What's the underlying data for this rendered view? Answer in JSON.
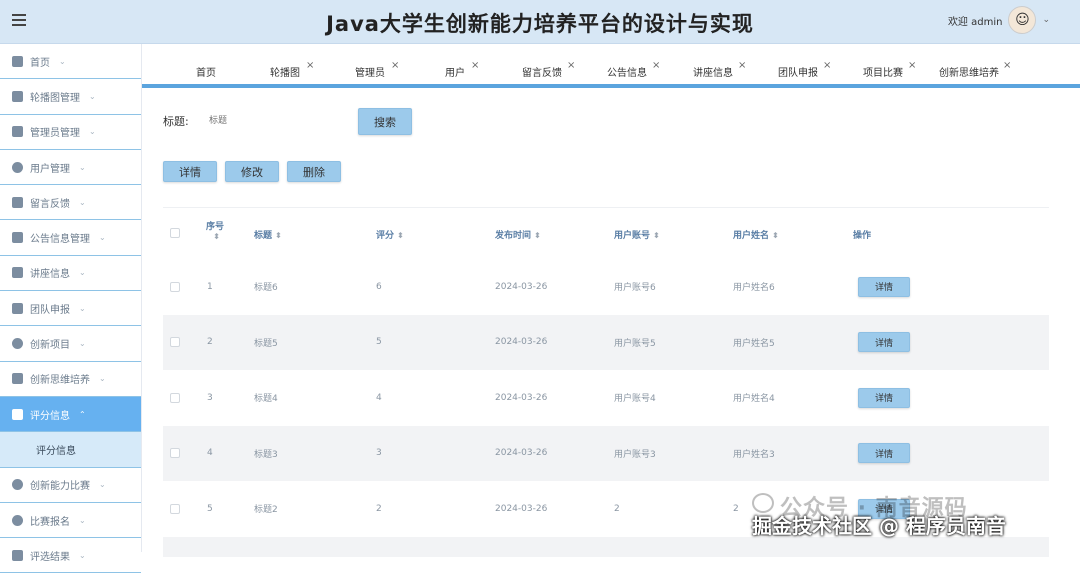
{
  "header": {
    "title": "Java大学生创新能力培养平台的设计与实现",
    "welcome": "欢迎 admin"
  },
  "sidebar": {
    "items": [
      {
        "label": "首页",
        "icon": "home-icon"
      },
      {
        "label": "轮播图管理",
        "icon": "carousel-icon"
      },
      {
        "label": "管理员管理",
        "icon": "admin-icon"
      },
      {
        "label": "用户管理",
        "icon": "user-icon"
      },
      {
        "label": "留言反馈",
        "icon": "message-icon"
      },
      {
        "label": "公告信息管理",
        "icon": "notice-icon"
      },
      {
        "label": "讲座信息",
        "icon": "lecture-icon"
      },
      {
        "label": "团队申报",
        "icon": "team-icon"
      },
      {
        "label": "创新项目",
        "icon": "project-icon"
      },
      {
        "label": "创新思维培养",
        "icon": "mail-icon"
      },
      {
        "label": "评分信息",
        "icon": "grid-icon"
      },
      {
        "label": "创新能力比赛",
        "icon": "compete-icon"
      },
      {
        "label": "比赛报名",
        "icon": "drop-icon"
      },
      {
        "label": "评选结果",
        "icon": "result-icon"
      }
    ],
    "sub_item": "评分信息"
  },
  "tabs": [
    "首页",
    "轮播图",
    "管理员",
    "用户",
    "留言反馈",
    "公告信息",
    "讲座信息",
    "团队申报",
    "项目比赛",
    "创新思维培养"
  ],
  "search": {
    "label": "标题:",
    "placeholder": "标题",
    "button": "搜索"
  },
  "actions": {
    "detail": "详情",
    "edit": "修改",
    "delete": "删除"
  },
  "table": {
    "headers": [
      "序号",
      "标题",
      "评分",
      "发布时间",
      "用户账号",
      "用户姓名",
      "操作"
    ],
    "rows": [
      {
        "no": "1",
        "title": "标题6",
        "score": "6",
        "time": "2024-03-26",
        "account": "用户账号6",
        "name": "用户姓名6",
        "op": "详情"
      },
      {
        "no": "2",
        "title": "标题5",
        "score": "5",
        "time": "2024-03-26",
        "account": "用户账号5",
        "name": "用户姓名5",
        "op": "详情"
      },
      {
        "no": "3",
        "title": "标题4",
        "score": "4",
        "time": "2024-03-26",
        "account": "用户账号4",
        "name": "用户姓名4",
        "op": "详情"
      },
      {
        "no": "4",
        "title": "标题3",
        "score": "3",
        "time": "2024-03-26",
        "account": "用户账号3",
        "name": "用户姓名3",
        "op": "详情"
      },
      {
        "no": "5",
        "title": "标题2",
        "score": "2",
        "time": "2024-03-26",
        "account": "2",
        "name": "2",
        "op": "详情"
      }
    ]
  },
  "watermark": {
    "line1": "公众号 · 南音源码",
    "line2": "掘金技术社区 @ 程序员南音"
  }
}
